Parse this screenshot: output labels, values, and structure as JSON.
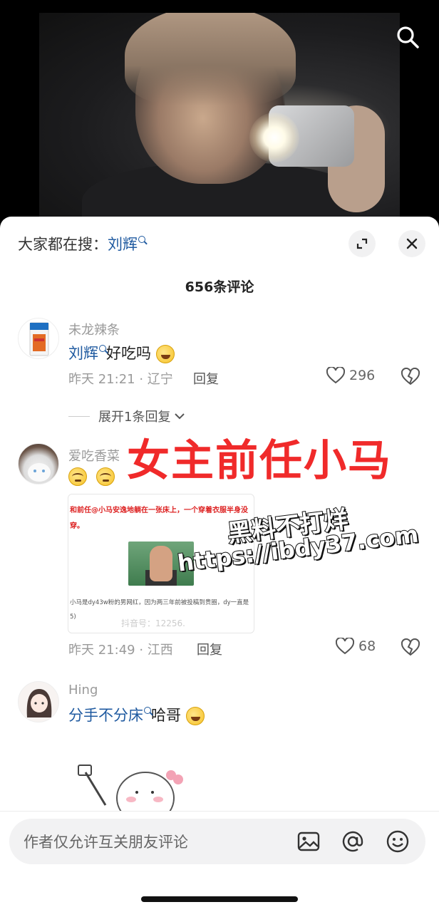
{
  "hot_search": {
    "prefix": "大家都在搜：",
    "keyword": "刘辉"
  },
  "comments_count": "656条评论",
  "comments": [
    {
      "username": "未龙辣条",
      "keyword": "刘辉",
      "text": "好吃吗",
      "emoji": "laughing-tears-emoji",
      "time_location": "昨天 21:21 · 辽宁",
      "reply_label": "回复",
      "likes": "296",
      "expand_replies": "展开1条回复"
    },
    {
      "username": "爱吃香菜",
      "emoji": [
        "squint-emoji",
        "squint-emoji"
      ],
      "image_card": {
        "header": "和前任@小马安逸地躺在一张床上，一个穿着衣服半身没穿。",
        "body": "小马是dy43w粉的男网红，因为两三年前被投稿到贵圈，dy一直是",
        "body_suffix": "5)",
        "watermark": "抖音号：12256."
      },
      "time_location": "昨天 21:49 · 江西",
      "reply_label": "回复",
      "likes": "68"
    },
    {
      "username": "Hing",
      "keyword": "分手不分床",
      "text": "哈哥",
      "emoji": "laughing-tears-emoji"
    }
  ],
  "overlay_title": "女主前任小马",
  "watermark_line1": "黑料不打烊",
  "watermark_line2": "https://ibdy37.com",
  "input_placeholder": "作者仅允许互关朋友评论",
  "colors": {
    "keyword": "#1f5aa0",
    "overlay_red": "#f02a2a"
  }
}
